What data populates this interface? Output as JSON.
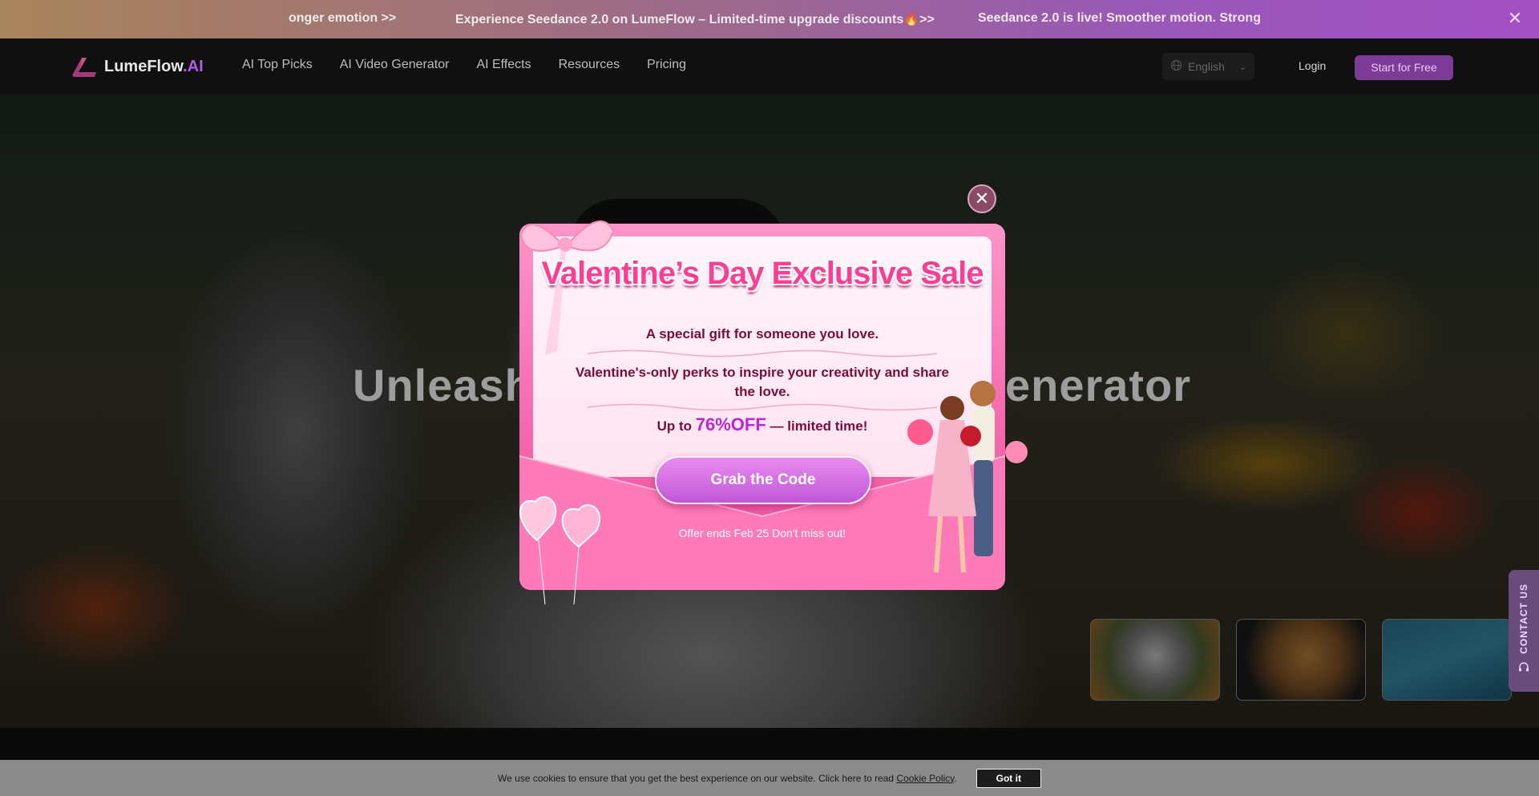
{
  "announcement": {
    "items": [
      "onger emotion >>",
      "Experience Seedance 2.0 on LumeFlow – Limited-time upgrade discounts🔥>>",
      "Seedance 2.0 is live! Smoother motion. Strong"
    ],
    "close_icon": "close-icon"
  },
  "nav": {
    "logo_name": "LumeFlow",
    "logo_suffix": ".AI",
    "menu": [
      "AI Top Picks",
      "AI Video Generator",
      "AI Effects",
      "Resources",
      "Pricing"
    ],
    "language": "English",
    "login": "Login",
    "start": "Start for Free"
  },
  "hero": {
    "title": "Unleash                                               enerator",
    "title_left": "Unleash",
    "title_right": "enerator"
  },
  "contact": {
    "label": "CONTACT US",
    "icon": "headset-icon"
  },
  "cookie": {
    "message": "We use cookies to ensure that you get the best experience on our website. Click here to read",
    "policy_link": "Cookie Policy",
    "period": ".",
    "button": "Got it"
  },
  "modal": {
    "headline": "Valentine’s Day Exclusive Sale",
    "line1": "A special gift for someone you love.",
    "line2": "Valentine's-only perks to inspire your creativity and share the love.",
    "line3_prefix": "Up to ",
    "line3_pct": "76%OFF",
    "line3_suffix": " — limited time!",
    "cta": "Grab the Code",
    "offer": "Offer ends Feb 25 Don't miss out!"
  },
  "colors": {
    "accent": "#b45cf0",
    "start_button": "#7d3a97",
    "modal_pink": "#f569ae",
    "headline_pink": "#ff3d95"
  }
}
